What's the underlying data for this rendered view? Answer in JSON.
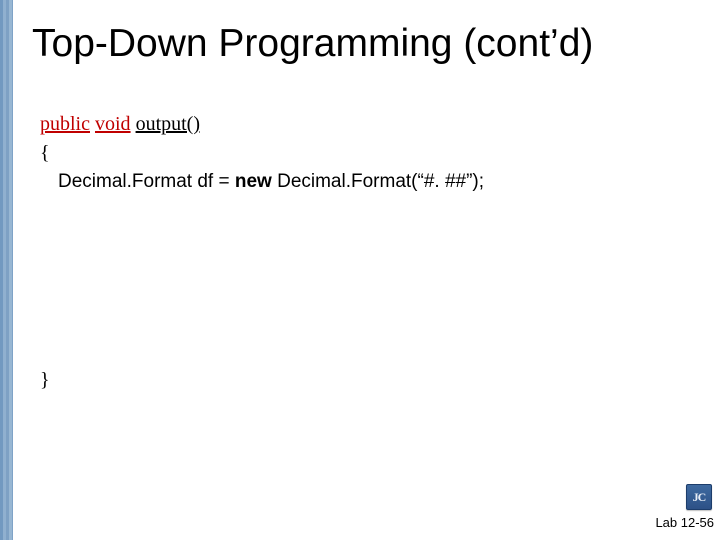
{
  "title": "Top-Down Programming (cont’d)",
  "signature": {
    "kw1": "public",
    "kw2": "void",
    "method": "output()"
  },
  "brace_open": "{",
  "code": {
    "p1": "Decimal.Format df = ",
    "kw_new": "new",
    "p2": " Decimal.Format(“#. ##”);"
  },
  "brace_close": "}",
  "badge": "JC",
  "footer": "Lab 12-56"
}
